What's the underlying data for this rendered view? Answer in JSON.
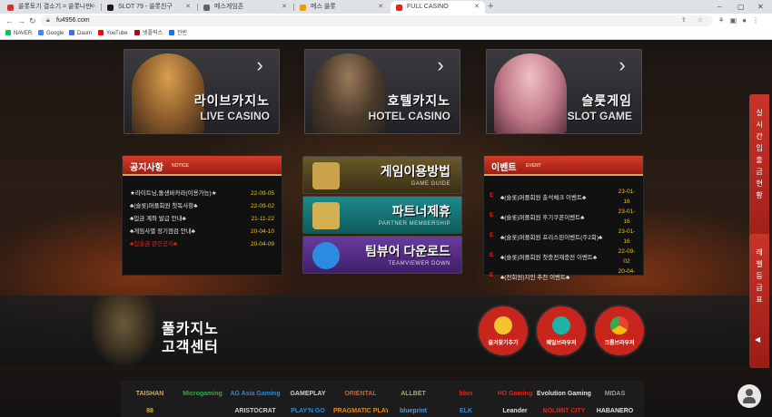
{
  "browser": {
    "tabs": [
      {
        "label": "쏠롯토기 결소기 = 쏠롯나만 - ",
        "fav_color": "#d93025"
      },
      {
        "label": "SLOT 79 - 쏠롯친구",
        "fav_color": "#1a1a1a"
      },
      {
        "label": "메스게임존",
        "fav_color": "#5f6368"
      },
      {
        "label": "메스 쏠롯",
        "fav_color": "#f29900"
      },
      {
        "label": "FULL CASINO",
        "fav_color": "#e0241a"
      }
    ],
    "new_tab": "+",
    "url": "fu4956.com",
    "window_controls": [
      "–",
      "▢",
      "✕"
    ],
    "bookmarks": [
      {
        "label": "NAVER",
        "color": "#03c75a"
      },
      {
        "label": "Google",
        "color": "#4285f4"
      },
      {
        "label": "Daum",
        "color": "#3b6cf1"
      },
      {
        "label": "YouTube",
        "color": "#ff0000"
      },
      {
        "label": "넷플릭스",
        "color": "#b20710"
      },
      {
        "label": "잔빈",
        "color": "#1a73e8"
      }
    ]
  },
  "banners": [
    {
      "kr": "라이브카지노",
      "en": "LIVE CASINO",
      "art": "#b07a3a"
    },
    {
      "kr": "호텔카지노",
      "en": "HOTEL CASINO",
      "art": "#5a4a3a"
    },
    {
      "kr": "슬롯게임",
      "en": "SLOT GAME",
      "art": "#d99aa8"
    }
  ],
  "notice": {
    "title": "공지사항",
    "sub": "NOTICE",
    "items": [
      {
        "text": "★라이트닝,돌생바카라(이용가능)★",
        "date": "22-09-05"
      },
      {
        "text": "♣(슬롯)퍼플회원 첫독사항♣",
        "date": "22-09-02"
      },
      {
        "text": "♣입금 계좌 발급 안내♣",
        "date": "21-11-22"
      },
      {
        "text": "♣게임사별 정기점검 안내♣",
        "date": "20-04-10"
      },
      {
        "text": "♣입출금 관련공지♣",
        "date": "20-04-09"
      }
    ]
  },
  "center_buttons": [
    {
      "kr": "게임이용방법",
      "en": "GAME GUIDE",
      "bg": "linear-gradient(180deg,#6a5a2a,#3a2f15)",
      "ico": "#c9a24a"
    },
    {
      "kr": "파트너제휴",
      "en": "PARTNER MEMBERSHIP",
      "bg": "linear-gradient(180deg,#1f8a8a,#0d5c5c)",
      "ico": "#d4b050"
    },
    {
      "kr": "팀뷰어 다운로드",
      "en": "TEAMVIEWER DOWN",
      "bg": "linear-gradient(180deg,#6b3aa0,#3f1f6a)",
      "ico": "#2a8be0"
    }
  ],
  "event": {
    "title": "이벤트",
    "sub": "EVENT",
    "items": [
      {
        "mark": "E",
        "text": "♣(슬롯)퍼플회원 출석체크 이벤트♣",
        "date_a": "23-01-",
        "date_b": "16"
      },
      {
        "mark": "E",
        "text": "♣(슬롯)퍼플회원 후기쿠폰이벤트♣",
        "date_a": "23-01-",
        "date_b": "16"
      },
      {
        "mark": "E",
        "text": "♣(슬롯)퍼플회원 프리스핀이벤트(주2회)♣",
        "date_a": "23-01-",
        "date_b": "16"
      },
      {
        "mark": "E",
        "text": "♣(슬롯)퍼플회원 첫충전재충전 이벤트♣",
        "date_a": "22-09-",
        "date_b": "02"
      },
      {
        "mark": "E",
        "text": "♣(전회원)지인 추천 이벤트♣",
        "date_a": "20-04-",
        "date_b": ""
      }
    ]
  },
  "support": {
    "line1": "풀카지노",
    "line2": "고객센터",
    "circles": [
      {
        "label": "즐겨찾기추가",
        "bg": "#c8261c",
        "ico": "#f4c430"
      },
      {
        "label": "웨일브라우저",
        "bg": "#c8261c",
        "ico": "#1fb2a6"
      },
      {
        "label": "크롬브라우저",
        "bg": "#c8261c",
        "ico": "#4285f4"
      }
    ]
  },
  "partners_row1": [
    {
      "name": "TAISHAN",
      "color": "#d8b030"
    },
    {
      "name": "Microgaming",
      "color": "#2fae4a"
    },
    {
      "name": "AG Asia Gaming",
      "color": "#2a8be0"
    },
    {
      "name": "GAMEPLAY",
      "color": "#cfcfcf"
    },
    {
      "name": "ORIENTAL",
      "color": "#d0602a"
    },
    {
      "name": "ALLBET",
      "color": "#b8a070"
    },
    {
      "name": "bbin",
      "color": "#e0241a"
    },
    {
      "name": "HO Gaming",
      "color": "#e0241a"
    },
    {
      "name": "Evolution Gaming",
      "color": "#e0e0e0"
    },
    {
      "name": "MIDAS",
      "color": "#9a9a9a"
    }
  ],
  "partners_row2": [
    {
      "name": "88",
      "color": "#d8b030"
    },
    {
      "name": "",
      "color": "#888"
    },
    {
      "name": "ARISTOCRAT",
      "color": "#cfcfcf"
    },
    {
      "name": "PLAY'N GO",
      "color": "#2a8be0"
    },
    {
      "name": "PRAGMATIC PLAY",
      "color": "#e08a2a"
    },
    {
      "name": "blueprint",
      "color": "#4a9be0"
    },
    {
      "name": "ELK",
      "color": "#2a8be0"
    },
    {
      "name": "Leander",
      "color": "#e0e0e0"
    },
    {
      "name": "NOLIMIT CITY",
      "color": "#e0241a"
    },
    {
      "name": "HABANERO",
      "color": "#e0e0e0"
    }
  ],
  "side_tabs": [
    {
      "text": "실시간입출금현황",
      "arrow": "◀"
    },
    {
      "text": "레벨등급표",
      "arrow": "◀"
    }
  ]
}
